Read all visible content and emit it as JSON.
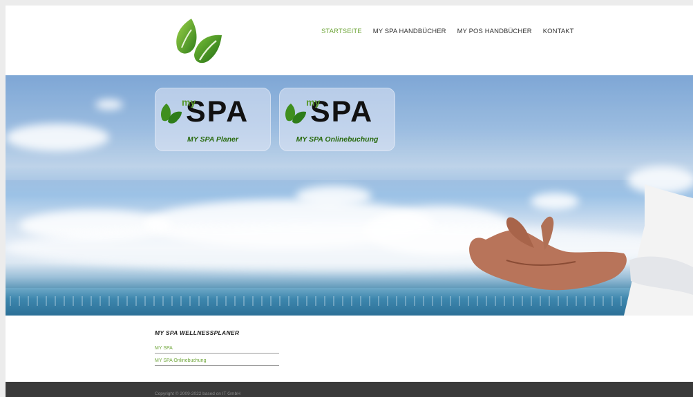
{
  "header": {
    "logo": {
      "icon": "leaf-logo-icon",
      "colors": [
        "#2e7d1a",
        "#6fbf3a"
      ]
    }
  },
  "nav": {
    "items": [
      {
        "label": "STARTSEITE",
        "active": true
      },
      {
        "label": "MY SPA HANDBÜCHER",
        "active": false
      },
      {
        "label": "MY POS HANDBÜCHER",
        "active": false
      },
      {
        "label": "KONTAKT",
        "active": false
      }
    ],
    "active_color": "#6fa63a"
  },
  "hero": {
    "cards": [
      {
        "brand_small": "my",
        "brand_large": "SPA",
        "caption": "MY SPA Planer"
      },
      {
        "brand_small": "my",
        "brand_large": "SPA",
        "caption": "MY SPA Onlinebuchung"
      }
    ]
  },
  "content": {
    "section_title": "MY SPA WELLNESSPLANER",
    "links": [
      "MY SPA",
      "MY SPA Onlinebuchung"
    ]
  },
  "footer": {
    "copyright": "Copyright © 2009-2022 based on IT GmbH"
  }
}
